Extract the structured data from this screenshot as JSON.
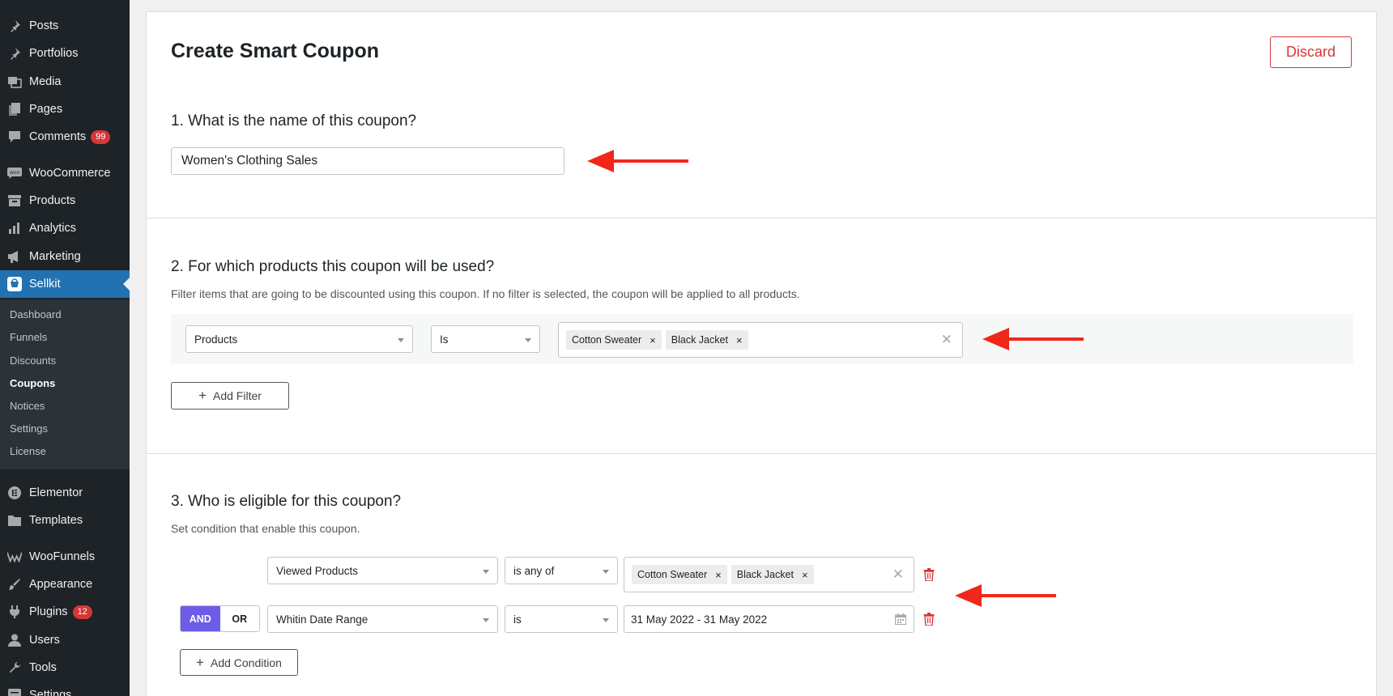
{
  "sidebar": {
    "menu": [
      {
        "label": "Posts",
        "icon": "pin-icon"
      },
      {
        "label": "Portfolios",
        "icon": "pin-icon"
      },
      {
        "label": "Media",
        "icon": "media-icon"
      },
      {
        "label": "Pages",
        "icon": "pages-icon"
      },
      {
        "label": "Comments",
        "icon": "comment-icon",
        "badge": "99"
      },
      {
        "label": "WooCommerce",
        "icon": "woo-icon"
      },
      {
        "label": "Products",
        "icon": "archive-icon"
      },
      {
        "label": "Analytics",
        "icon": "bar-chart-icon"
      },
      {
        "label": "Marketing",
        "icon": "megaphone-icon"
      },
      {
        "label": "Sellkit",
        "icon": "sellkit-icon",
        "active": true
      },
      {
        "label": "Elementor",
        "icon": "elementor-icon"
      },
      {
        "label": "Templates",
        "icon": "folder-icon"
      },
      {
        "label": "WooFunnels",
        "icon": "woofunnels-icon"
      },
      {
        "label": "Appearance",
        "icon": "brush-icon"
      },
      {
        "label": "Plugins",
        "icon": "plug-icon",
        "badge": "12"
      },
      {
        "label": "Users",
        "icon": "user-icon"
      },
      {
        "label": "Tools",
        "icon": "wrench-icon"
      },
      {
        "label": "Settings",
        "icon": "settings-icon"
      }
    ],
    "submenu": [
      "Dashboard",
      "Funnels",
      "Discounts",
      "Coupons",
      "Notices",
      "Settings",
      "License"
    ],
    "current_submenu": "Coupons"
  },
  "page": {
    "title": "Create Smart Coupon",
    "discard_label": "Discard"
  },
  "section1": {
    "title": "1. What is the name of this coupon?",
    "name_value": "Women's Clothing Sales"
  },
  "section2": {
    "title": "2. For which products this coupon will be used?",
    "description": "Filter items that are going to be discounted using this coupon. If no filter is selected, the coupon will be applied to all products.",
    "filter": {
      "field": "Products",
      "operator": "Is",
      "tags": [
        "Cotton Sweater",
        "Black Jacket"
      ]
    },
    "add_filter_label": "Add Filter"
  },
  "section3": {
    "title": "3. Who is eligible for this coupon?",
    "description": "Set condition that enable this coupon.",
    "condition1": {
      "field": "Viewed Products",
      "operator": "is any of",
      "tags": [
        "Cotton Sweater",
        "Black Jacket"
      ]
    },
    "logic": {
      "and_label": "AND",
      "or_label": "OR",
      "selected": "AND"
    },
    "condition2": {
      "field": "Whitin Date Range",
      "operator": "is",
      "date_range": "31 May 2022 - 31 May 2022"
    },
    "add_condition_label": "Add Condition"
  },
  "colors": {
    "sidebar_bg": "#1d2327",
    "submenu_bg": "#2c3338",
    "active_blue": "#2271b1",
    "discard_red": "#d63638",
    "arrow_red": "#f2271b",
    "and_purple": "#6c5ce7"
  }
}
